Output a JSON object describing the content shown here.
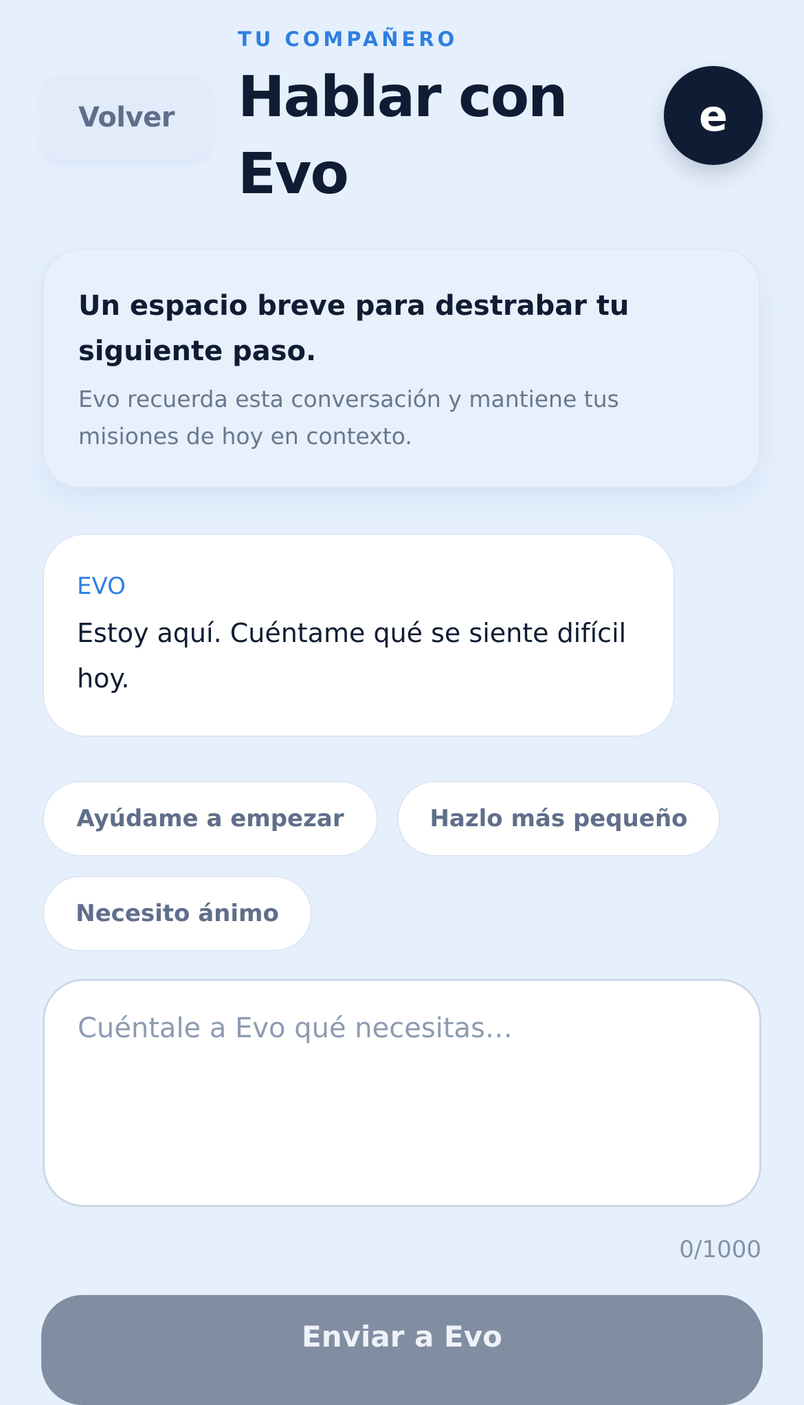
{
  "header": {
    "back_label": "Volver",
    "eyebrow": "TU COMPAÑERO",
    "title": "Hablar con Evo",
    "avatar_letter": "e"
  },
  "intro": {
    "heading": "Un espacio breve para destrabar tu siguiente paso.",
    "subtext": "Evo recuerda esta conversación y mantiene tus misiones de hoy en contexto."
  },
  "messages": [
    {
      "sender": "EVO",
      "text": "Estoy aquí. Cuéntame qué se siente difícil hoy."
    }
  ],
  "quick_replies": [
    "Ayúdame a empezar",
    "Hazlo más pequeño",
    "Necesito ánimo"
  ],
  "composer": {
    "placeholder": "Cuéntale a Evo qué necesitas…",
    "value": "",
    "counter": "0/1000",
    "send_label": "Enviar a Evo"
  },
  "colors": {
    "background": "#e6f0fd",
    "accent": "#2f7fe0",
    "dark": "#0f1c33",
    "send_disabled": "#818da1"
  }
}
